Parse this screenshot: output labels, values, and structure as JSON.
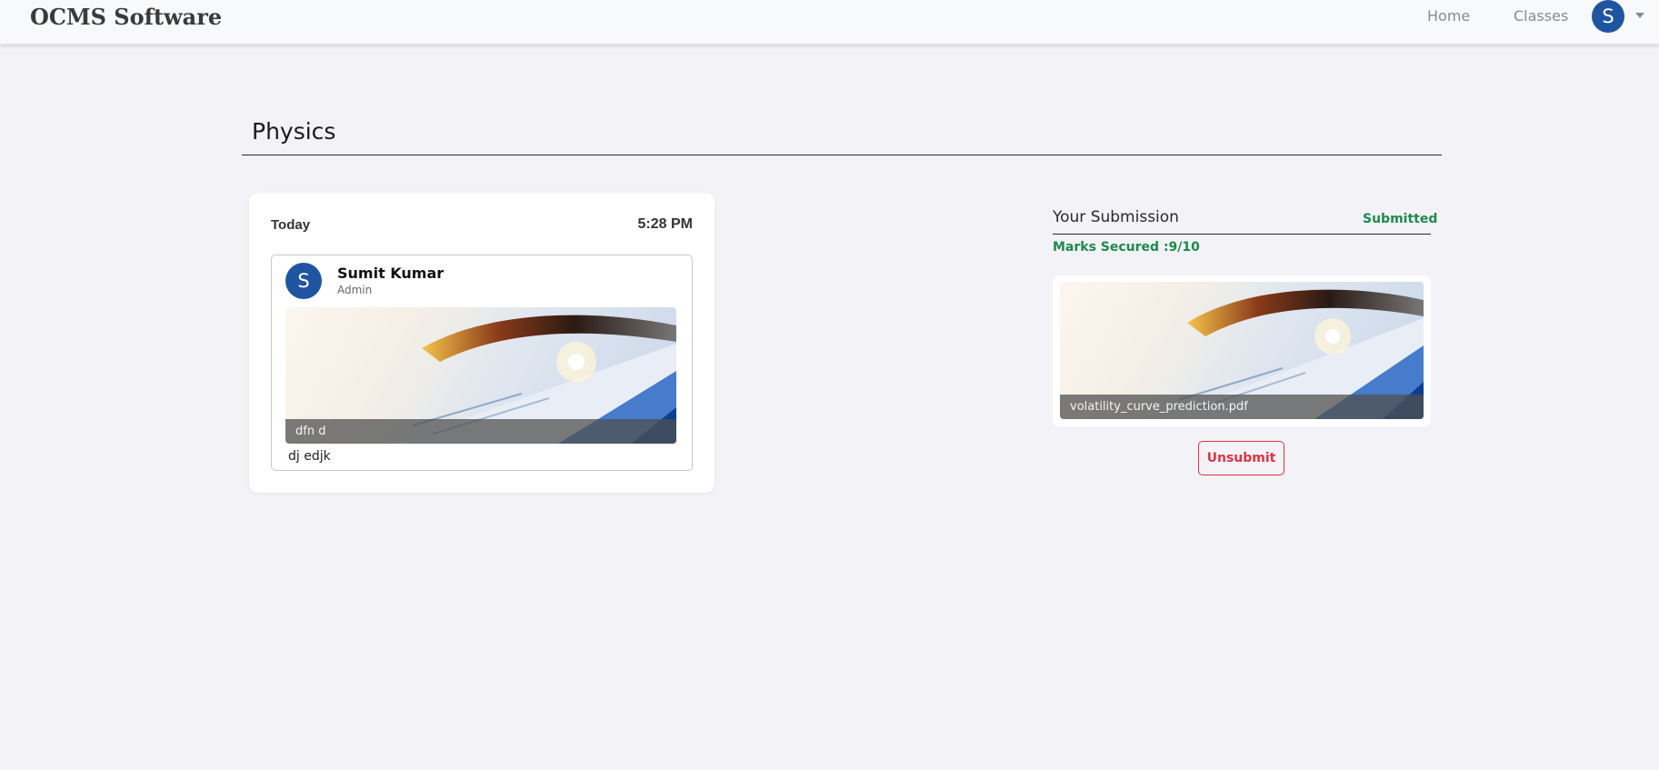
{
  "navbar": {
    "brand": "OCMS Software",
    "links": [
      "Home",
      "Classes"
    ],
    "user_initial": "S"
  },
  "class_name": "Physics",
  "post": {
    "day": "Today",
    "time": "5:28 PM",
    "author": {
      "initial": "S",
      "name": "Sumit Kumar",
      "role": "Admin"
    },
    "attachment_caption": "dfn d",
    "description": "dj edjk"
  },
  "submission": {
    "title": "Your Submission",
    "status": "Submitted",
    "marks": "Marks Secured :9/10",
    "file_name": "volatility_curve_prediction.pdf",
    "unsubmit_label": "Unsubmit"
  },
  "colors": {
    "brand_blue": "#1f55a0",
    "success_green": "#1e8a4c",
    "danger_red": "#dc3545"
  }
}
